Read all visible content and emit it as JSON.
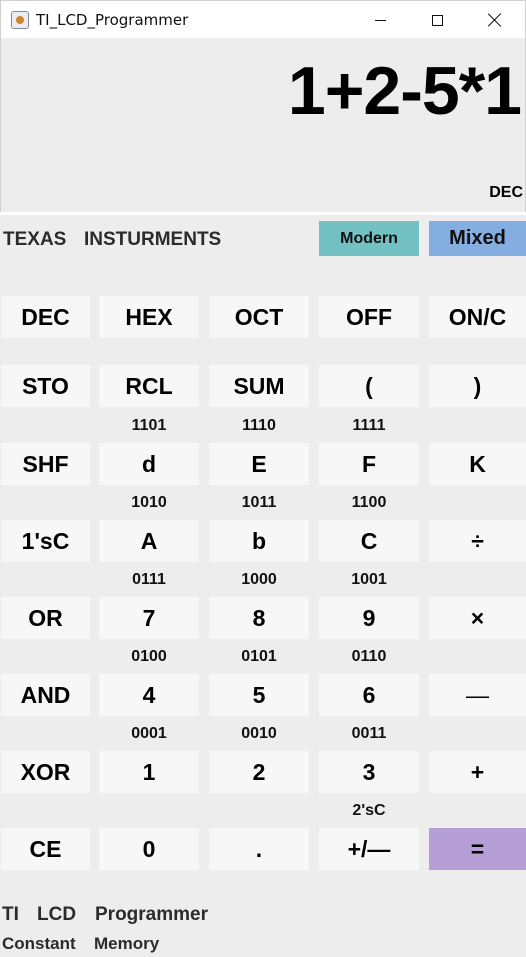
{
  "window": {
    "title": "TI_LCD_Programmer",
    "icon": "java-cup-icon",
    "controls": [
      "minimize",
      "maximize",
      "close"
    ]
  },
  "display": {
    "expression": "1+2-5*1",
    "mode_indicator": "DEC"
  },
  "branding": {
    "brand_word_1": "TEXAS",
    "brand_word_2": "INSTURMENTS",
    "style_buttons": {
      "modern": "Modern",
      "mixed": "Mixed"
    }
  },
  "keys": {
    "r1": [
      "DEC",
      "HEX",
      "OCT",
      "OFF",
      "ON/C"
    ],
    "r2": [
      "STO",
      "RCL",
      "SUM",
      "(",
      ")"
    ],
    "r3": [
      "SHF",
      "d",
      "E",
      "F",
      "K"
    ],
    "r4": [
      "1'sC",
      "A",
      "b",
      "C",
      "÷"
    ],
    "r5": [
      "OR",
      "7",
      "8",
      "9",
      "×"
    ],
    "r6": [
      "AND",
      "4",
      "5",
      "6",
      "—"
    ],
    "r7": [
      "XOR",
      "1",
      "2",
      "3",
      "+"
    ],
    "r8": [
      "CE",
      "0",
      ".",
      "+/—",
      "="
    ]
  },
  "sublabels": {
    "s3": [
      "1101",
      "1110",
      "1111"
    ],
    "s4": [
      "1010",
      "1011",
      "1100"
    ],
    "s5": [
      "0111",
      "1000",
      "1001"
    ],
    "s6": [
      "0100",
      "0101",
      "0110"
    ],
    "s7": [
      "0001",
      "0010",
      "0011"
    ],
    "s8": "2'sC"
  },
  "footer": {
    "line1": [
      "TI",
      "LCD",
      "Programmer"
    ],
    "line2": [
      "Constant",
      "Memory"
    ]
  },
  "colors": {
    "background": "#ededed",
    "key": "#f7f7f7",
    "modern": "#74c1c4",
    "mixed": "#84aee0",
    "equals": "#b59fd6"
  }
}
